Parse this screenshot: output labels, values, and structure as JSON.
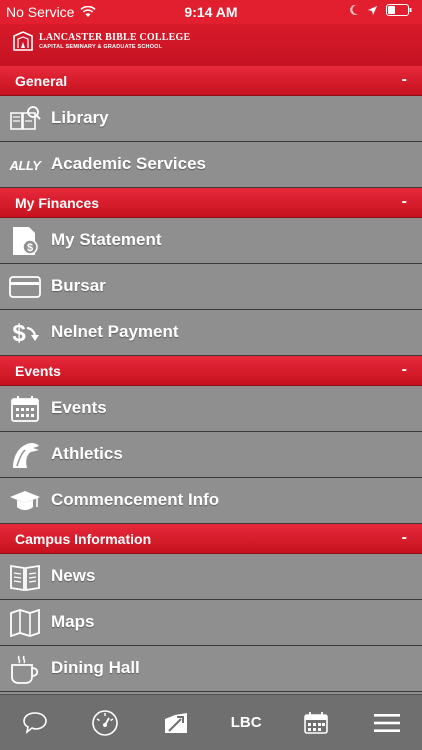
{
  "status_bar": {
    "carrier": "No Service",
    "time": "9:14 AM"
  },
  "header": {
    "logo_line1": "LANCASTER BIBLE COLLEGE",
    "logo_line2": "CAPITAL SEMINARY & GRADUATE SCHOOL"
  },
  "sections": [
    {
      "title": "General",
      "toggle": "-",
      "items": [
        {
          "label": "Library",
          "icon": "library-icon"
        },
        {
          "label": "Academic Services",
          "icon": "ally-icon",
          "icon_text": "ALLY"
        }
      ]
    },
    {
      "title": "My Finances",
      "toggle": "-",
      "items": [
        {
          "label": "My Statement",
          "icon": "statement-icon"
        },
        {
          "label": "Bursar",
          "icon": "credit-card-icon"
        },
        {
          "label": "Nelnet Payment",
          "icon": "dollar-transfer-icon"
        }
      ]
    },
    {
      "title": "Events",
      "toggle": "-",
      "items": [
        {
          "label": "Events",
          "icon": "calendar-icon"
        },
        {
          "label": "Athletics",
          "icon": "mascot-icon"
        },
        {
          "label": "Commencement Info",
          "icon": "graduation-cap-icon"
        }
      ]
    },
    {
      "title": "Campus Information",
      "toggle": "-",
      "items": [
        {
          "label": "News",
          "icon": "newspaper-icon"
        },
        {
          "label": "Maps",
          "icon": "map-icon"
        },
        {
          "label": "Dining Hall",
          "icon": "coffee-cup-icon"
        }
      ]
    }
  ],
  "tab_bar": {
    "tabs": [
      {
        "name": "chat-icon"
      },
      {
        "name": "dashboard-icon"
      },
      {
        "name": "campus-icon"
      },
      {
        "name": "lbc-text",
        "label": "LBC"
      },
      {
        "name": "calendar-tab-icon"
      },
      {
        "name": "menu-icon"
      }
    ]
  },
  "colors": {
    "accent": "#e21f2f",
    "list_bg": "#8f8f8f",
    "tab_bg": "#6f6f6f"
  }
}
